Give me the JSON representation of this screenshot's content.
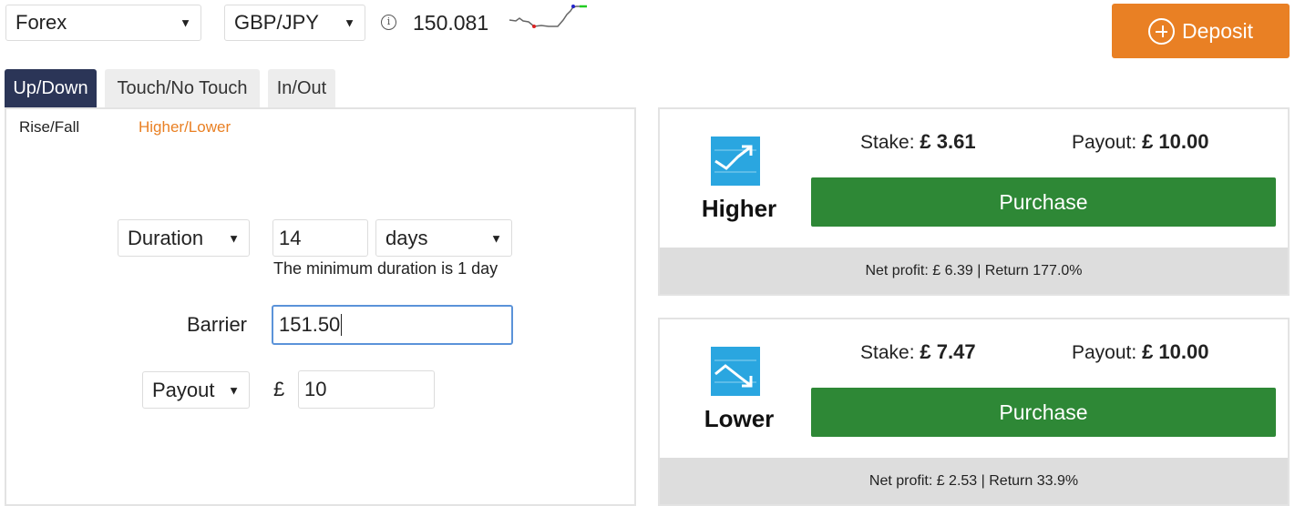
{
  "top_bar": {
    "market": "Forex",
    "symbol": "GBP/JPY",
    "info_glyph": "i",
    "spot_price": "150.081",
    "deposit_label": "Deposit"
  },
  "tabs": [
    {
      "label": "Up/Down",
      "active": true
    },
    {
      "label": "Touch/No Touch",
      "active": false
    },
    {
      "label": "In/Out",
      "active": false
    }
  ],
  "subtabs": [
    {
      "label": "Rise/Fall",
      "active": false
    },
    {
      "label": "Higher/Lower",
      "active": true
    }
  ],
  "form": {
    "duration_type": "Duration",
    "duration_value": "14",
    "duration_unit": "days",
    "duration_note": "The minimum duration is 1 day",
    "barrier_label": "Barrier",
    "barrier_value": "151.50",
    "amount_type": "Payout",
    "currency_symbol": "£",
    "amount_value": "10"
  },
  "contracts": [
    {
      "name": "Higher",
      "stake_label": "Stake:",
      "stake_value": "£ 3.61",
      "payout_label": "Payout:",
      "payout_value": "£ 10.00",
      "purchase_label": "Purchase",
      "footer": "Net profit: £ 6.39 | Return 177.0%"
    },
    {
      "name": "Lower",
      "stake_label": "Stake:",
      "stake_value": "£ 7.47",
      "payout_label": "Payout:",
      "payout_value": "£ 10.00",
      "purchase_label": "Purchase",
      "footer": "Net profit: £ 2.53 | Return 33.9%"
    }
  ],
  "colors": {
    "accent_orange": "#e98024",
    "tab_active": "#2b3557",
    "purchase_green": "#2e8836",
    "icon_blue": "#2aa6e0"
  }
}
